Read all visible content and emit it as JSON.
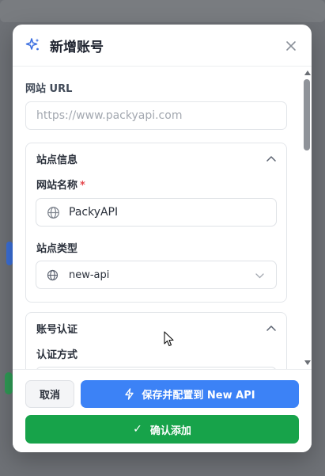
{
  "dialog": {
    "title": "新增账号",
    "header_icon": "sparkles-icon",
    "close_icon": "close-icon"
  },
  "form": {
    "url_label": "网站 URL",
    "url_placeholder": "https://www.packyapi.com",
    "url_value": ""
  },
  "site_info": {
    "title": "站点信息",
    "name_label": "网站名称",
    "required_mark": "*",
    "name_value": "PackyAPI",
    "type_label": "站点类型",
    "type_value": "new-api"
  },
  "auth": {
    "title": "账号认证",
    "method_label": "认证方式"
  },
  "footer": {
    "cancel_label": "取消",
    "save_label": "保存并配置到 New API",
    "confirm_label": "确认添加",
    "confirm_icon": "✓"
  },
  "colors": {
    "primary": "#3c82f6",
    "success": "#17a34a",
    "required": "#e5484d"
  }
}
